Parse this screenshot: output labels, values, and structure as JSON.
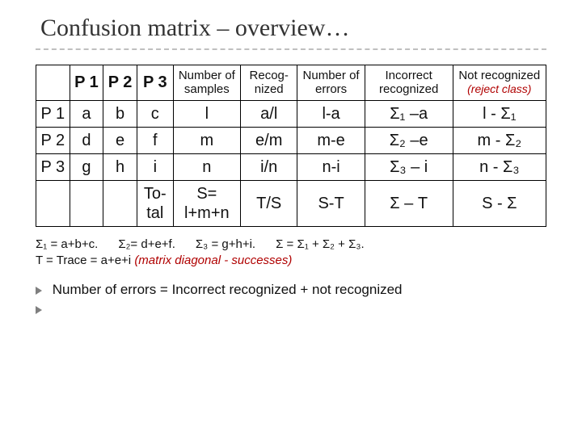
{
  "title": "Confusion matrix – overview…",
  "table": {
    "headers": {
      "p1": "P 1",
      "p2": "P 2",
      "p3": "P 3",
      "num_samples": "Number of samples",
      "recognized": "Recog-nized",
      "num_errors": "Number of errors",
      "incorrect": "Incorrect recognized",
      "not_recog": "Not recognized",
      "not_recog_sub": "(reject class)"
    },
    "rows": [
      {
        "p": "P 1",
        "c1": "a",
        "c2": "b",
        "c3": "c",
        "ns": "l",
        "rec": "a/l",
        "ne": "l-a",
        "inc": "Σ₁ –a",
        "nr": "l - Σ₁"
      },
      {
        "p": "P 2",
        "c1": "d",
        "c2": "e",
        "c3": "f",
        "ns": "m",
        "rec": "e/m",
        "ne": "m-e",
        "inc": "Σ₂ –e",
        "nr": "m - Σ₂"
      },
      {
        "p": "P 3",
        "c1": "g",
        "c2": "h",
        "c3": "i",
        "ns": "n",
        "rec": "i/n",
        "ne": "n-i",
        "inc": "Σ₃ – i",
        "nr": "n - Σ₃"
      }
    ],
    "total": {
      "label": "To-tal",
      "ns_top": "S=",
      "ns_bot": "l+m+n",
      "rec": "T/S",
      "ne": "S-T",
      "inc": "Σ – T",
      "nr": "S - Σ"
    }
  },
  "notes": {
    "line1a": "Σ₁ = a+b+c.",
    "line1b": "Σ₂= d+e+f.",
    "line1c": "Σ₃ = g+h+i.",
    "line1d": "Σ = Σ₁ + Σ₂ + Σ₃.",
    "line2a": "T = Trace = a+e+i",
    "line2b": "(matrix diagonal - successes)"
  },
  "bullet": "Number of errors = Incorrect recognized + not recognized"
}
